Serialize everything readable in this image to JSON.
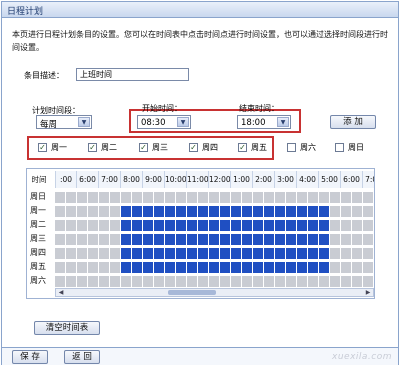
{
  "window": {
    "title": "日程计划"
  },
  "description": "本页进行日程计划条目的设置。您可以在时间表中点击时间点进行时间设置，也可以通过选择时间段进行时间设置。",
  "entry": {
    "label": "条目描述：",
    "value": "上班时间"
  },
  "period": {
    "label": "计划时间段：",
    "value": "每周"
  },
  "start": {
    "label": "开始时间：",
    "value": "08:30"
  },
  "end": {
    "label": "结束时间：",
    "value": "18:00"
  },
  "add_button": "添 加",
  "days": [
    {
      "label": "周一",
      "checked": true,
      "mark": "✓"
    },
    {
      "label": "周二",
      "checked": true,
      "mark": "✓"
    },
    {
      "label": "周三",
      "checked": true,
      "mark": "✓"
    },
    {
      "label": "周四",
      "checked": true,
      "mark": "✓"
    },
    {
      "label": "周五",
      "checked": true,
      "mark": "✓"
    },
    {
      "label": "周六",
      "checked": false,
      "mark": ""
    },
    {
      "label": "周日",
      "checked": false,
      "mark": ""
    }
  ],
  "schedule": {
    "header_label": "时间",
    "hours": [
      ":00",
      "6:00",
      "7:00",
      "8:00",
      "9:00",
      "10:00",
      "11:00",
      "12:00",
      "1:00",
      "2:00",
      "3:00",
      "4:00",
      "5:00",
      "6:00",
      "7:00",
      "8:00"
    ],
    "rows": [
      "周日",
      "周一",
      "周二",
      "周三",
      "周四",
      "周五",
      "周六"
    ],
    "active_rows": [
      1,
      2,
      3,
      4,
      5
    ],
    "active_cols_from": 6,
    "active_cols_to": 24,
    "col_count": 32
  },
  "clear_button": "清空时间表",
  "save_button": "保 存",
  "back_button": "返 回",
  "watermark": "xuexila.com"
}
